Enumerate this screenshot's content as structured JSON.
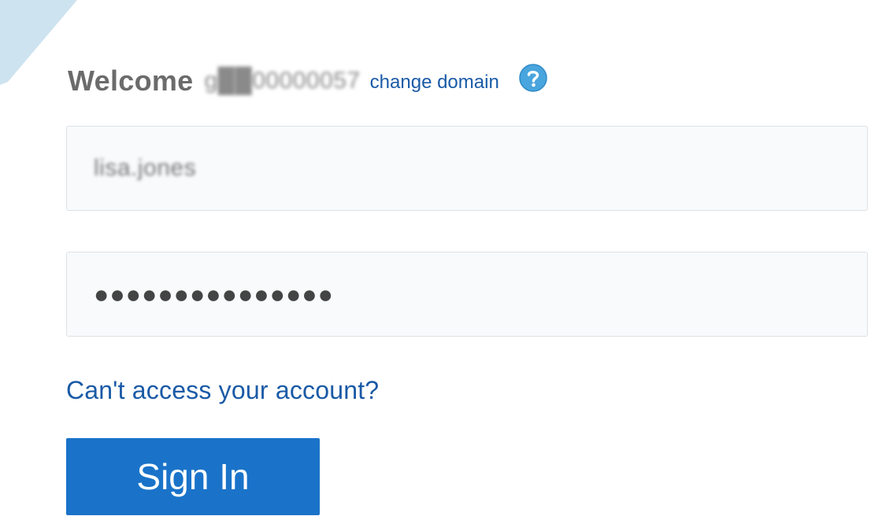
{
  "header": {
    "welcome_label": "Welcome",
    "domain_value": "g██00000057",
    "change_domain_label": "change domain",
    "help_icon": "question-circle-icon"
  },
  "form": {
    "username_value": "lisa.jones",
    "password_value": "●●●●●●●●●●●●●●●"
  },
  "links": {
    "cant_access_label": "Can't access your account?"
  },
  "actions": {
    "sign_in_label": "Sign In"
  },
  "colors": {
    "accent": "#1a73c9",
    "link": "#1a5aa6",
    "help_icon": "#49a5dd",
    "corner_decoration": "#cde3ef",
    "field_border": "#dde1e6",
    "field_background": "#f8fafc"
  }
}
